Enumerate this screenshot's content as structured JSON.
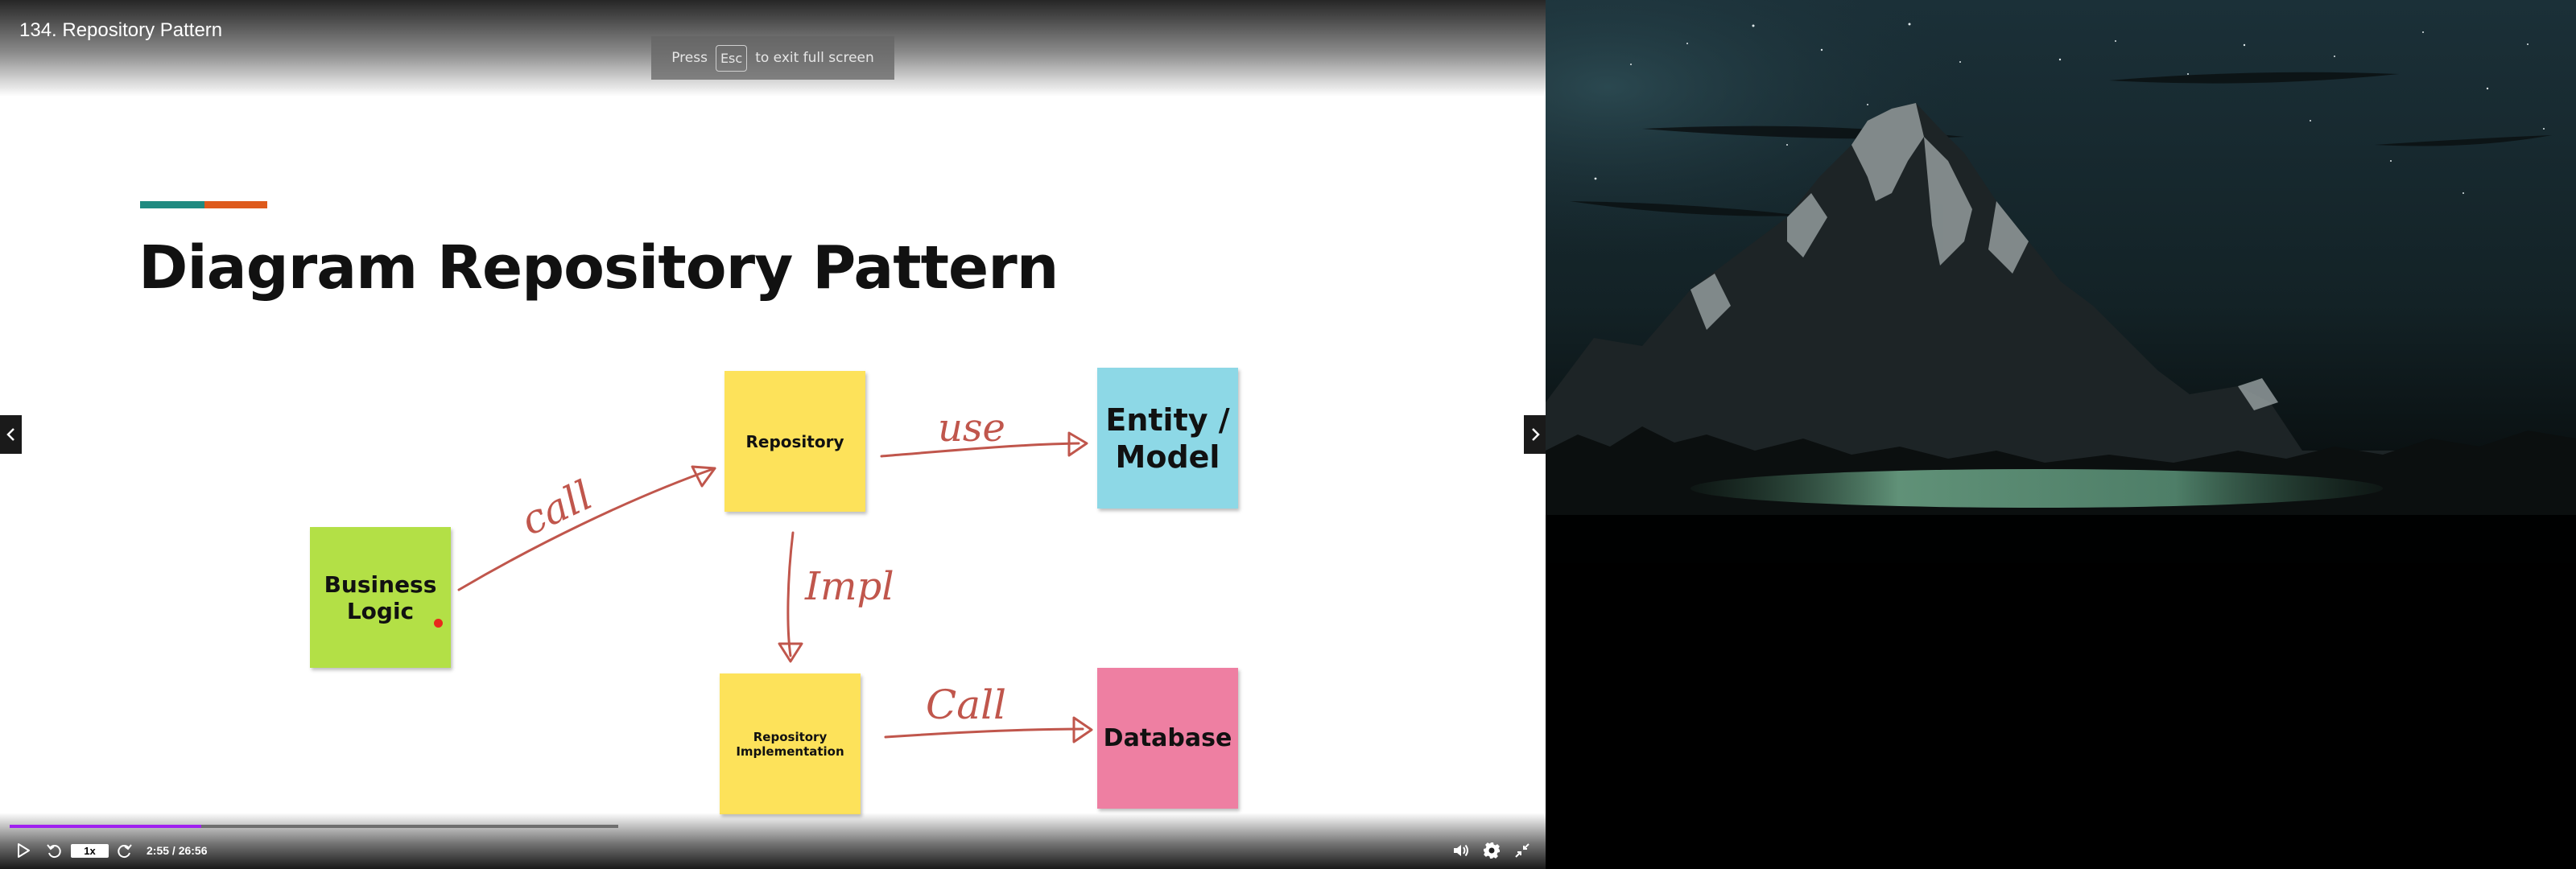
{
  "player": {
    "title": "134. Repository Pattern",
    "fullscreen_notice": {
      "prefix": "Press",
      "key": "Esc",
      "suffix": "to exit full screen"
    }
  },
  "slide": {
    "title": "Diagram Repository Pattern",
    "accent_colors": [
      "#1f8a80",
      "#de5a1c"
    ],
    "notes": {
      "business_logic": "Business Logic",
      "repository": "Repository",
      "entity_model": "Entity / Model",
      "repository_implementation": "Repository Implementation",
      "database": "Database"
    },
    "note_colors": {
      "green": "#b3e046",
      "yellow": "#fde25a",
      "blue": "#8dd8e6",
      "pink": "#ee7fa2"
    },
    "annotations": {
      "call_1": "call",
      "use": "use",
      "impl": "Impl",
      "call_2": "Call"
    },
    "ink_color": "#c0564c"
  },
  "controls": {
    "speed": "1x",
    "time": "2:55 / 26:56",
    "progress_fraction": 0.13,
    "buffered_fraction": 0.4,
    "progress_color": "#a020f0"
  },
  "icons": {
    "play": "play-icon",
    "rewind": "rewind-icon",
    "forward": "forward-icon",
    "volume": "volume-icon",
    "settings": "gear-icon",
    "exit_fullscreen": "exit-fullscreen-icon",
    "prev": "chevron-left-icon",
    "next": "chevron-right-icon"
  }
}
